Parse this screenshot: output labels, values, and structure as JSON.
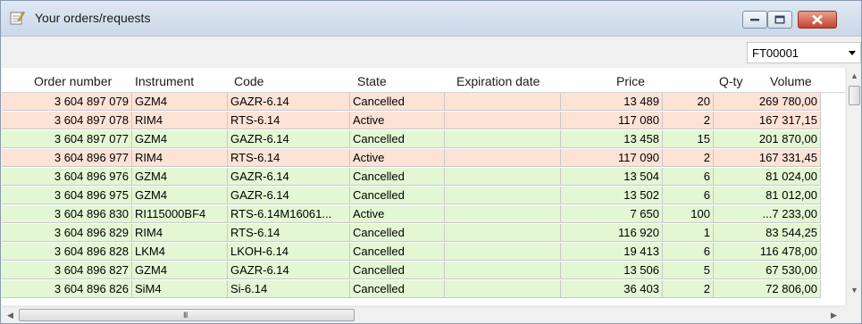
{
  "window": {
    "title": "Your orders/requests",
    "icon": "notepad-icon"
  },
  "filter": {
    "account_value": "FT00001"
  },
  "colors": {
    "cancelled_row": "#e3f7d4",
    "active_row": "#fde3d6",
    "header_bg": "#ffffff",
    "titlebar": "#d4e0ee",
    "close_button": "#c75a46"
  },
  "columns": [
    "Order number",
    "Instrument",
    "Code",
    "State",
    "Expiration date",
    "Price",
    "Q-ty",
    "Volume"
  ],
  "rows": [
    {
      "order": "3 604 897 079",
      "instrument": "GZM4",
      "code": "GAZR-6.14",
      "state": "Cancelled",
      "expiration": "",
      "price": "13 489",
      "qty": "20",
      "volume": "269 780,00",
      "color": "#fde3d6"
    },
    {
      "order": "3 604 897 078",
      "instrument": "RIM4",
      "code": "RTS-6.14",
      "state": "Active",
      "expiration": "",
      "price": "117 080",
      "qty": "2",
      "volume": "167 317,15",
      "color": "#fde3d6"
    },
    {
      "order": "3 604 897 077",
      "instrument": "GZM4",
      "code": "GAZR-6.14",
      "state": "Cancelled",
      "expiration": "",
      "price": "13 458",
      "qty": "15",
      "volume": "201 870,00",
      "color": "#e3f7d4"
    },
    {
      "order": "3 604 896 977",
      "instrument": "RIM4",
      "code": "RTS-6.14",
      "state": "Active",
      "expiration": "",
      "price": "117 090",
      "qty": "2",
      "volume": "167 331,45",
      "color": "#fde3d6"
    },
    {
      "order": "3 604 896 976",
      "instrument": "GZM4",
      "code": "GAZR-6.14",
      "state": "Cancelled",
      "expiration": "",
      "price": "13 504",
      "qty": "6",
      "volume": "81 024,00",
      "color": "#e3f7d4"
    },
    {
      "order": "3 604 896 975",
      "instrument": "GZM4",
      "code": "GAZR-6.14",
      "state": "Cancelled",
      "expiration": "",
      "price": "13 502",
      "qty": "6",
      "volume": "81 012,00",
      "color": "#e3f7d4"
    },
    {
      "order": "3 604 896 830",
      "instrument": "RI115000BF4",
      "code": "RTS-6.14M16061...",
      "state": "Active",
      "expiration": "",
      "price": "7 650",
      "qty": "100",
      "volume": "...7 233,00",
      "color": "#e3f7d4"
    },
    {
      "order": "3 604 896 829",
      "instrument": "RIM4",
      "code": "RTS-6.14",
      "state": "Cancelled",
      "expiration": "",
      "price": "116 920",
      "qty": "1",
      "volume": "83 544,25",
      "color": "#e3f7d4"
    },
    {
      "order": "3 604 896 828",
      "instrument": "LKM4",
      "code": "LKOH-6.14",
      "state": "Cancelled",
      "expiration": "",
      "price": "19 413",
      "qty": "6",
      "volume": "116 478,00",
      "color": "#e3f7d4"
    },
    {
      "order": "3 604 896 827",
      "instrument": "GZM4",
      "code": "GAZR-6.14",
      "state": "Cancelled",
      "expiration": "",
      "price": "13 506",
      "qty": "5",
      "volume": "67 530,00",
      "color": "#e3f7d4"
    },
    {
      "order": "3 604 896 826",
      "instrument": "SiM4",
      "code": "Si-6.14",
      "state": "Cancelled",
      "expiration": "",
      "price": "36 403",
      "qty": "2",
      "volume": "72 806,00",
      "color": "#e3f7d4"
    }
  ],
  "scrollbar": {
    "horizontal_grip": "III"
  }
}
